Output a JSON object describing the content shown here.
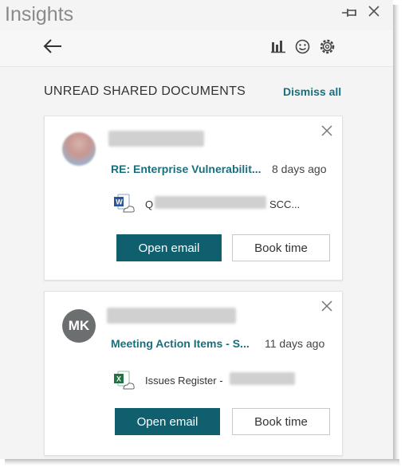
{
  "window": {
    "title": "Insights",
    "pin_icon": "pin-icon",
    "close_icon": "close-icon"
  },
  "toolbar": {
    "back_icon": "back-arrow-icon",
    "chart_icon": "bar-chart-icon",
    "feedback_icon": "smiley-icon",
    "settings_icon": "gear-icon"
  },
  "section": {
    "title": "UNREAD SHARED DOCUMENTS",
    "dismiss_all": "Dismiss all"
  },
  "cards": [
    {
      "avatar_initials": "",
      "subject": "RE: Enterprise Vulnerabilit...",
      "age": "8 days ago",
      "file_icon": "word-icon",
      "file_prefix": "Q",
      "file_suffix": "SCC...",
      "open_label": "Open email",
      "book_label": "Book time"
    },
    {
      "avatar_initials": "MK",
      "subject": "Meeting Action Items - S...",
      "age": "11 days ago",
      "file_icon": "excel-icon",
      "file_prefix": "Issues Register -",
      "file_suffix": "",
      "open_label": "Open email",
      "book_label": "Book time"
    }
  ],
  "colors": {
    "accent": "#1a6f7d",
    "primary_button": "#0f5f6e",
    "avatar_mk": "#6b6f6f",
    "word_blue": "#2b579a",
    "excel_green": "#217346"
  }
}
